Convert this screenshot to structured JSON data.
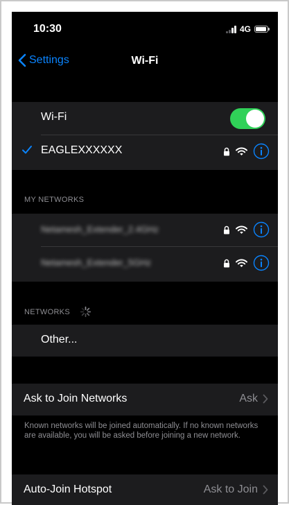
{
  "status_bar": {
    "time": "10:30",
    "network_type": "4G",
    "icons": [
      "cellular-signal-icon",
      "battery-icon"
    ]
  },
  "nav": {
    "back_label": "Settings",
    "title": "Wi-Fi",
    "icons": [
      "chevron-left-icon"
    ]
  },
  "wifi_toggle": {
    "label": "Wi-Fi",
    "on": true
  },
  "connected_network": {
    "name": "EAGLEXXXXXX",
    "icons": [
      "checkmark-icon",
      "lock-icon",
      "wifi-icon",
      "info-icon"
    ]
  },
  "my_networks": {
    "header": "MY NETWORKS",
    "items": [
      {
        "name": "Netamesh_Extender_2.4GHz",
        "icons": [
          "lock-icon",
          "wifi-icon",
          "info-icon"
        ]
      },
      {
        "name": "Netamesh_Extender_5GHz",
        "icons": [
          "lock-icon",
          "wifi-icon",
          "info-icon"
        ]
      }
    ]
  },
  "networks": {
    "header": "NETWORKS",
    "other_label": "Other...",
    "icons": [
      "loading-spinner-icon"
    ]
  },
  "ask_to_join": {
    "label": "Ask to Join Networks",
    "value": "Ask",
    "footer": "Known networks will be joined automatically. If no known networks are available, you will be asked before joining a new network."
  },
  "auto_join_hotspot": {
    "label": "Auto-Join Hotspot",
    "value": "Ask to Join"
  },
  "colors": {
    "accent": "#0a84ff",
    "toggle_on": "#30d158",
    "background": "#000000",
    "cell_background": "#1c1c1e",
    "secondary_text": "#8e8e93"
  }
}
